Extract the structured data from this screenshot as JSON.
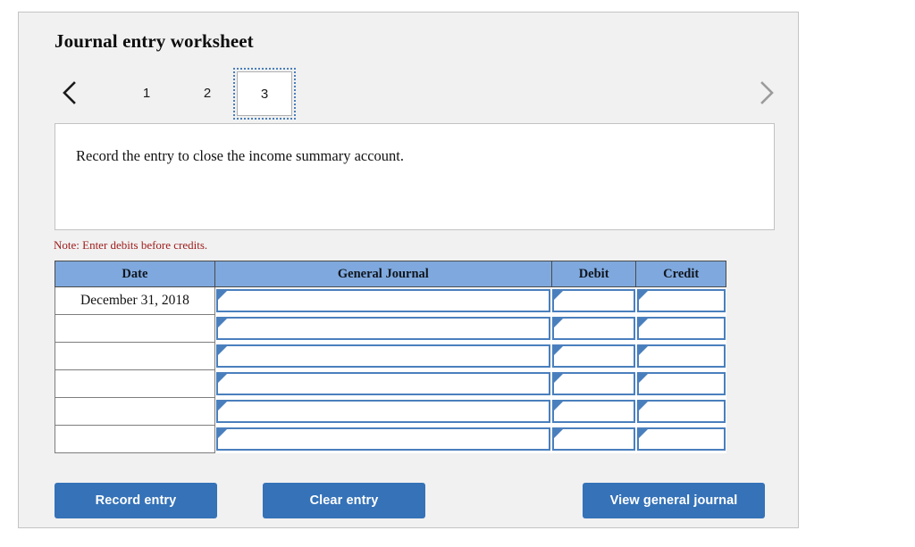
{
  "worksheet": {
    "title": "Journal entry worksheet",
    "nav": {
      "prev_icon": "chevron-left-icon",
      "next_icon": "chevron-right-icon",
      "tabs": [
        {
          "label": "1",
          "selected": false
        },
        {
          "label": "2",
          "selected": false
        },
        {
          "label": "3",
          "selected": true
        }
      ]
    },
    "instruction": "Record the entry to close the income summary account.",
    "note": "Note: Enter debits before credits.",
    "note_color": "#9e1b1b",
    "accent_color": "#3572b8",
    "header_color": "#7fa9de"
  },
  "table": {
    "headers": [
      "Date",
      "General Journal",
      "Debit",
      "Credit"
    ],
    "rows": [
      {
        "date": "December 31, 2018",
        "general_journal": "",
        "debit": "",
        "credit": ""
      },
      {
        "date": "",
        "general_journal": "",
        "debit": "",
        "credit": ""
      },
      {
        "date": "",
        "general_journal": "",
        "debit": "",
        "credit": ""
      },
      {
        "date": "",
        "general_journal": "",
        "debit": "",
        "credit": ""
      },
      {
        "date": "",
        "general_journal": "",
        "debit": "",
        "credit": ""
      },
      {
        "date": "",
        "general_journal": "",
        "debit": "",
        "credit": ""
      }
    ]
  },
  "buttons": {
    "record": "Record entry",
    "clear": "Clear entry",
    "view": "View general journal"
  }
}
